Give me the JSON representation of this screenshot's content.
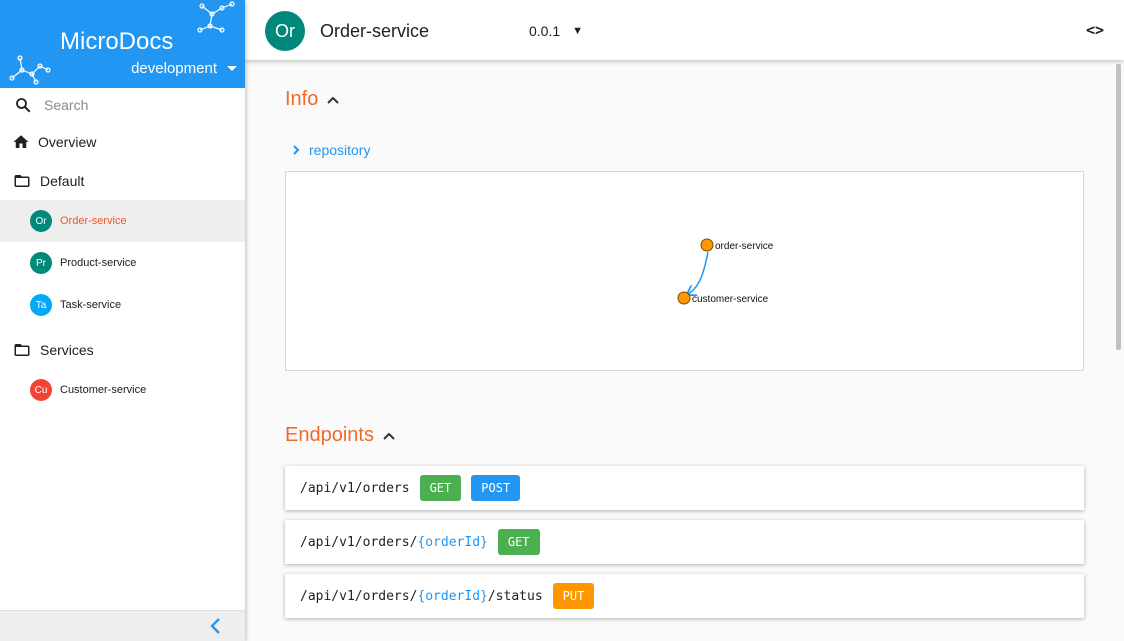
{
  "app": {
    "title": "MicroDocs",
    "environment": "development"
  },
  "colors": {
    "brand": "#2196f3",
    "accent": "#f06a2a",
    "get": "#4caf50",
    "post": "#2196f3",
    "put": "#ff9800"
  },
  "sidebar": {
    "search_placeholder": "Search",
    "overview": "Overview",
    "groups": [
      {
        "label": "Default",
        "services": [
          {
            "initials": "Or",
            "name": "Order-service",
            "color": "#00897b",
            "active": true
          },
          {
            "initials": "Pr",
            "name": "Product-service",
            "color": "#00897b",
            "active": false
          },
          {
            "initials": "Ta",
            "name": "Task-service",
            "color": "#03a9f4",
            "active": false
          }
        ]
      },
      {
        "label": "Services",
        "services": [
          {
            "initials": "Cu",
            "name": "Customer-service",
            "color": "#f44336",
            "active": false
          }
        ]
      }
    ]
  },
  "header": {
    "initials": "Or",
    "title": "Order-service",
    "version": "0.0.1",
    "code_label": "<>"
  },
  "info": {
    "title": "Info",
    "repository": "repository",
    "graph": {
      "nodes": [
        "order-service",
        "customer-service"
      ]
    }
  },
  "endpoints": {
    "title": "Endpoints",
    "items": [
      {
        "segments": [
          {
            "text": "/api/v1/orders",
            "param": false
          }
        ],
        "methods": [
          "GET",
          "POST"
        ]
      },
      {
        "segments": [
          {
            "text": "/api/v1/orders/",
            "param": false
          },
          {
            "text": "{orderId}",
            "param": true
          }
        ],
        "methods": [
          "GET"
        ]
      },
      {
        "segments": [
          {
            "text": "/api/v1/orders/",
            "param": false
          },
          {
            "text": "{orderId}",
            "param": true
          },
          {
            "text": "/status",
            "param": false
          }
        ],
        "methods": [
          "PUT"
        ]
      }
    ]
  }
}
